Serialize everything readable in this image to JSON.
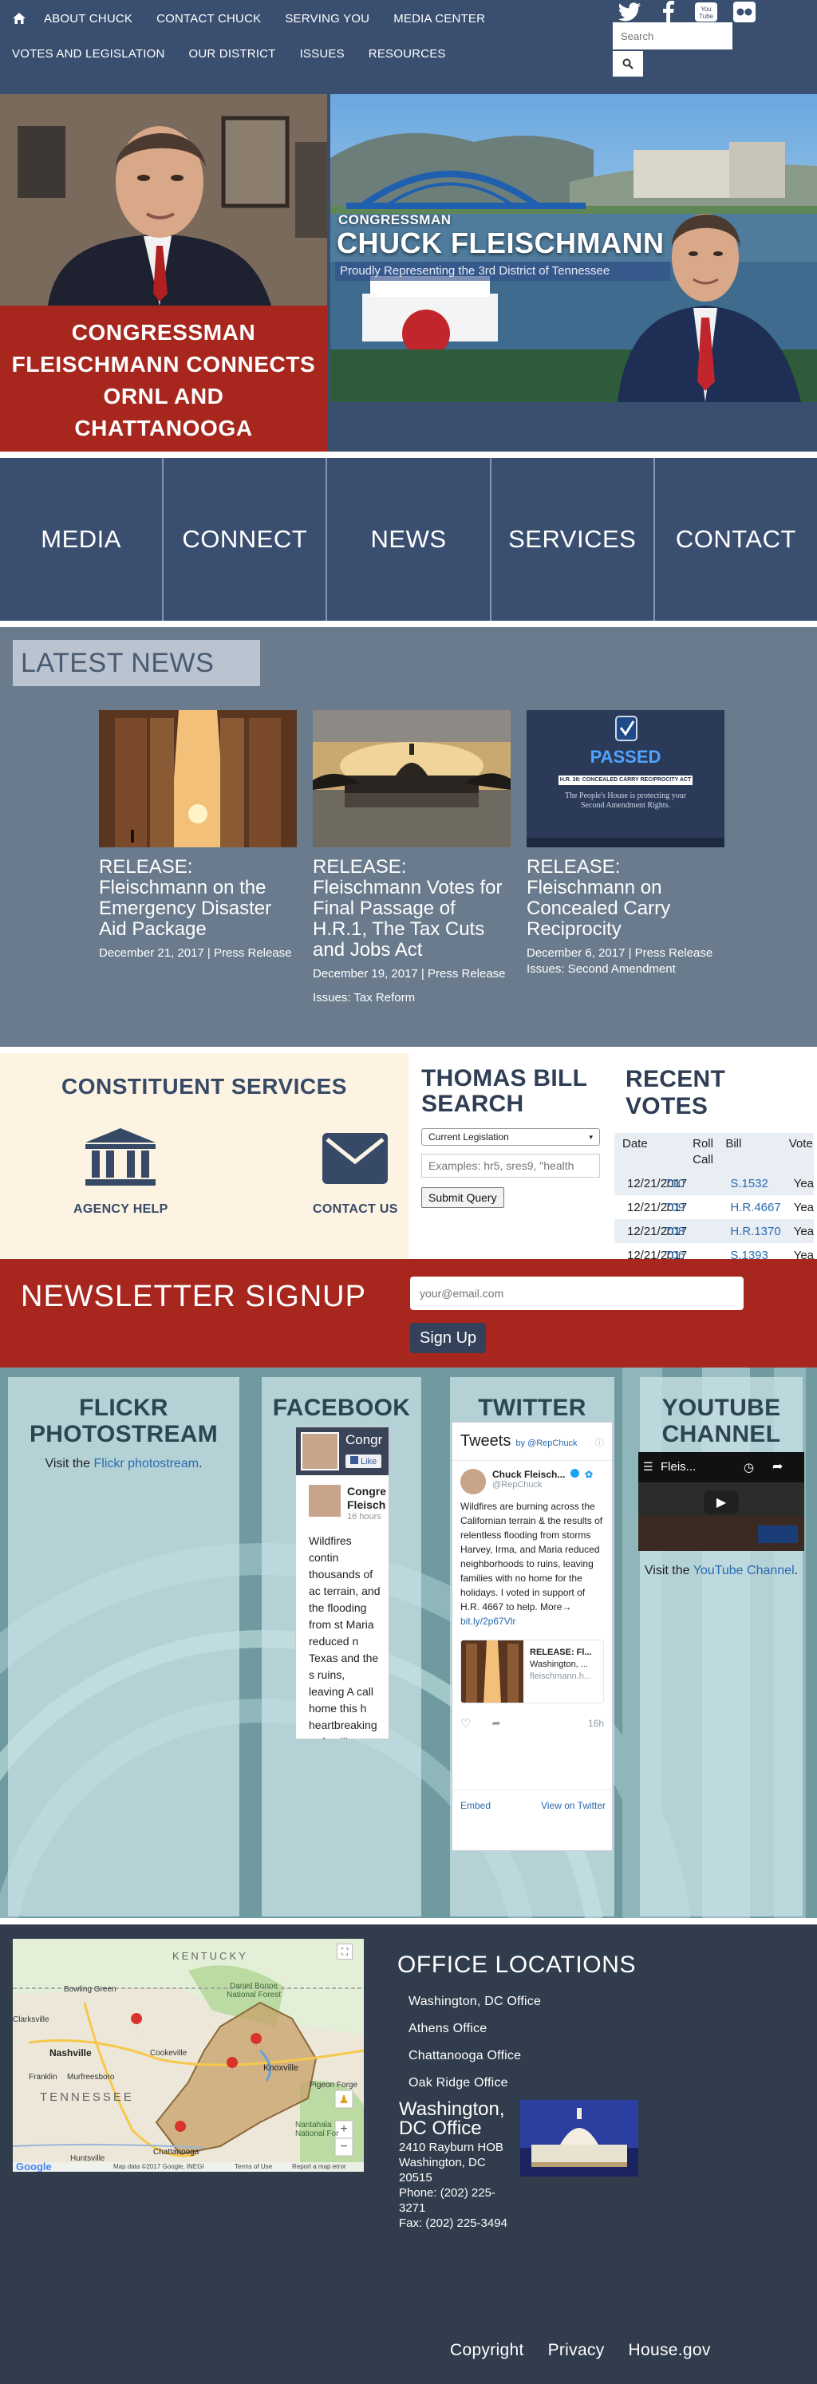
{
  "nav": {
    "row1": [
      "ABOUT CHUCK",
      "CONTACT CHUCK",
      "SERVING YOU",
      "MEDIA CENTER"
    ],
    "row2": [
      "VOTES AND LEGISLATION",
      "OUR DISTRICT",
      "ISSUES",
      "RESOURCES"
    ],
    "social": [
      "twitter-icon",
      "facebook-icon",
      "youtube-icon",
      "flickr-icon"
    ],
    "youtube_label": "You Tube",
    "search_placeholder": "Search"
  },
  "hero": {
    "caption": "CONGRESSMAN FLEISCHMANN CONNECTS ORNL AND CHATTANOOGA",
    "banner_small": "CONGRESSMAN",
    "banner_big": "CHUCK FLEISCHMANN",
    "banner_sub": "Proudly Representing the 3rd District of Tennessee"
  },
  "tiles": [
    "MEDIA",
    "CONNECT",
    "NEWS",
    "SERVICES",
    "CONTACT"
  ],
  "news": {
    "heading": "LATEST NEWS",
    "cards": [
      {
        "title": "RELEASE: Fleischmann on the Emergency Disaster Aid Package",
        "meta": "December 21, 2017 | Press Release",
        "issues": ""
      },
      {
        "title": "RELEASE: Fleischmann Votes for Final Passage of H.R.1, The Tax Cuts and Jobs Act",
        "meta": "December 19, 2017 | Press Release",
        "issues": "Issues: Tax Reform"
      },
      {
        "title": "RELEASE: Fleischmann on Concealed Carry Reciprocity",
        "meta": "December 6, 2017 | Press Release",
        "issues": "Issues: Second Amendment"
      }
    ],
    "passed_badge": "PASSED",
    "passed_bill": "H.R. 38: CONCEALED CARRY RECIPROCITY ACT",
    "passed_text": "The People's House is protecting your Second Amendment Rights."
  },
  "services": {
    "heading": "CONSTITUENT SERVICES",
    "agency_help": "AGENCY HELP",
    "contact_us": "CONTACT US"
  },
  "bill_search": {
    "heading": "THOMAS BILL SEARCH",
    "select_value": "Current Legislation",
    "input_placeholder": "Examples: hr5, sres9, \"health",
    "submit": "Submit Query"
  },
  "votes": {
    "heading": "RECENT VOTES",
    "columns": [
      "Date",
      "Roll Call",
      "Bill",
      "Vote"
    ],
    "rows": [
      {
        "date": "12/21/2017",
        "roll": "710",
        "bill": "S.1532",
        "vote": "Yea"
      },
      {
        "date": "12/21/2017",
        "roll": "709",
        "bill": "H.R.4667",
        "vote": "Yea"
      },
      {
        "date": "12/21/2017",
        "roll": "708",
        "bill": "H.R.1370",
        "vote": "Yea"
      },
      {
        "date": "12/21/2017",
        "roll": "706",
        "bill": "S.1393",
        "vote": "Yea"
      }
    ]
  },
  "newsletter": {
    "heading": "NEWSLETTER SIGNUP",
    "placeholder": "your@email.com",
    "button": "Sign Up"
  },
  "feeds": {
    "flickr": {
      "heading": "FLICKR PHOTOSTREAM",
      "text_before": "Visit the ",
      "link": "Flickr photostream",
      "text_after": "."
    },
    "facebook": {
      "heading": "FACEBOOK",
      "page_name": "Congr",
      "like": "Like",
      "post_name": "Congre Fleisch",
      "post_time": "16 hours",
      "post_text": "Wildfires contin thousands of ac terrain, and the flooding from st Maria reduced n Texas and the s ruins, leaving A call home this h heartbreaking re families. Today, legislation to he statement:"
    },
    "twitter": {
      "heading": "TWITTER FEED",
      "tweets_label": "Tweets",
      "by": "by @RepChuck",
      "name": "Chuck Fleisch...",
      "handle": "@RepChuck",
      "text": "Wildfires are burning across the Californian terrain & the results of relentless flooding from storms Harvey, Irma, and Maria reduced neighborhoods to ruins, leaving families with no home for the holidays. I voted in support of H.R. 4667 to help. More→",
      "link": "bit.ly/2p67Vlr",
      "card_title": "RELEASE: Fl...",
      "card_sub": "Washington, ...",
      "card_url": "fleischmann.h...",
      "time": "16h",
      "embed": "Embed",
      "view": "View on Twitter"
    },
    "youtube": {
      "heading": "YOUTUBE CHANNEL",
      "video_title": "Fleis...",
      "text_before": "Visit the ",
      "link": "YouTube Channel",
      "text_after": "."
    }
  },
  "office": {
    "heading": "OFFICE LOCATIONS",
    "locations": [
      "Washington, DC Office",
      "Athens Office",
      "Chattanooga Office",
      "Oak Ridge Office"
    ],
    "detail_title": "Washington, DC Office",
    "address_lines": [
      "2410 Rayburn HOB",
      "Washington, DC",
      "20515",
      "Phone: (202) 225-",
      "3271",
      "Fax: (202) 225-3494"
    ]
  },
  "map": {
    "labels": [
      "KENTUCKY",
      "Bowling Green",
      "Daniel Boone National Forest",
      "Clarksville",
      "Nashville",
      "Cookeville",
      "Knoxville",
      "Franklin",
      "Murfreesboro",
      "Pigeon Forge",
      "TENNESSEE",
      "Nantahala National For",
      "Chattanooga",
      "Huntsville"
    ],
    "footer": "Map data ©2017 Google, INEGI",
    "terms": "Terms of Use",
    "report": "Report a map error",
    "google": "Google"
  },
  "footer": [
    "Copyright",
    "Privacy",
    "House.gov"
  ],
  "colors": {
    "navy": "#3a4f70",
    "red": "#a7271e",
    "slate": "#697b8c",
    "dark": "#313c4c",
    "cream": "#fdf3e2",
    "link": "#2a6ab0"
  }
}
